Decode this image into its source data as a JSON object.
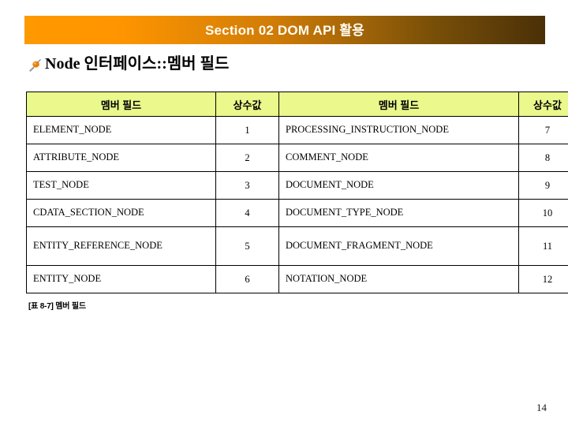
{
  "slide": {
    "banner": {
      "title": "Section 02 DOM API 활용",
      "gradient_start": "#FF9900",
      "gradient_end": "#4A3008",
      "text_color": "#FFFDF4"
    },
    "heading": {
      "bullet_icon": "pushpin-icon",
      "text": "Node 인터페이스::멤버 필드"
    },
    "table": {
      "header_bg": "#EAF88C",
      "headers": [
        "멤버 필드",
        "상수값",
        "멤버 필드",
        "상수값"
      ],
      "rows": [
        {
          "field1": "ELEMENT_NODE",
          "value1": "1",
          "field2": "PROCESSING_INSTRUCTION_NODE",
          "value2": "7",
          "tall": false
        },
        {
          "field1": "ATTRIBUTE_NODE",
          "value1": "2",
          "field2": "COMMENT_NODE",
          "value2": "8",
          "tall": false
        },
        {
          "field1": "TEST_NODE",
          "value1": "3",
          "field2": "DOCUMENT_NODE",
          "value2": "9",
          "tall": false
        },
        {
          "field1": "CDATA_SECTION_NODE",
          "value1": "4",
          "field2": "DOCUMENT_TYPE_NODE",
          "value2": "10",
          "tall": false
        },
        {
          "field1": "ENTITY_REFERENCE_NODE",
          "value1": "5",
          "field2": "DOCUMENT_FRAGMENT_NODE",
          "value2": "11",
          "tall": true
        },
        {
          "field1": "ENTITY_NODE",
          "value1": "6",
          "field2": "NOTATION_NODE",
          "value2": "12",
          "tall": false
        }
      ]
    },
    "caption": "[표 8-7] 멤버 필드",
    "page_number": "14"
  }
}
